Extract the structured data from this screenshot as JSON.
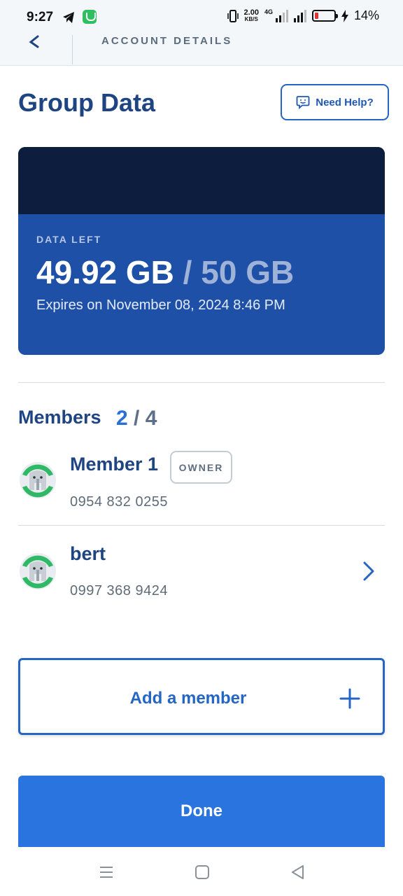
{
  "status_bar": {
    "time": "9:27",
    "speed_value": "2.00",
    "speed_unit": "KB/S",
    "network": "4G",
    "battery": "14%"
  },
  "header": {
    "title": "ACCOUNT DETAILS"
  },
  "page": {
    "title": "Group Data",
    "help_label": "Need Help?"
  },
  "data_card": {
    "label": "DATA LEFT",
    "used": "49.92 GB",
    "separator": " / ",
    "total": "50 GB",
    "expiry": "Expires on November 08, 2024 8:46 PM",
    "fraction_left": 0.9984
  },
  "members": {
    "title": "Members",
    "count_current": "2",
    "count_sep": " / ",
    "count_max": "4",
    "list": [
      {
        "name": "Member 1",
        "badge": "OWNER",
        "phone": "0954 832 0255"
      },
      {
        "name": "bert",
        "phone": "0997 368 9424"
      }
    ]
  },
  "actions": {
    "add_member": "Add a member",
    "done": "Done"
  },
  "colors": {
    "primary": "#2565c4",
    "title": "#1f4482",
    "card_dark": "#0c1d3d",
    "card_blue": "#1f50a8",
    "done": "#2a74e0"
  }
}
